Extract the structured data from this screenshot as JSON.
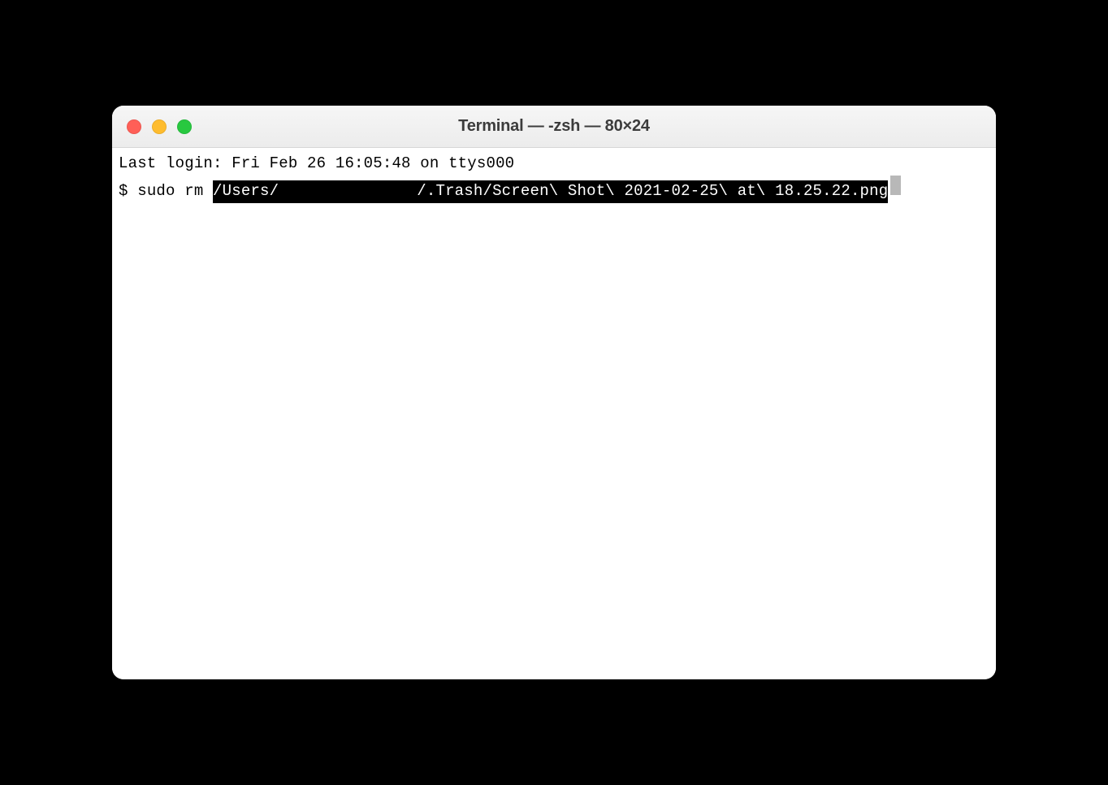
{
  "window": {
    "title": "Terminal — -zsh — 80×24"
  },
  "terminal": {
    "last_login": "Last login: Fri Feb 26 16:05:48 on ttys000",
    "prompt": "$ ",
    "command_prefix": "sudo rm ",
    "highlighted_path_part1": "/Users/",
    "highlighted_path_part2": "/.Trash/Screen\\ Shot\\ 2021-02-25\\ at\\ 18.25.22.png"
  }
}
